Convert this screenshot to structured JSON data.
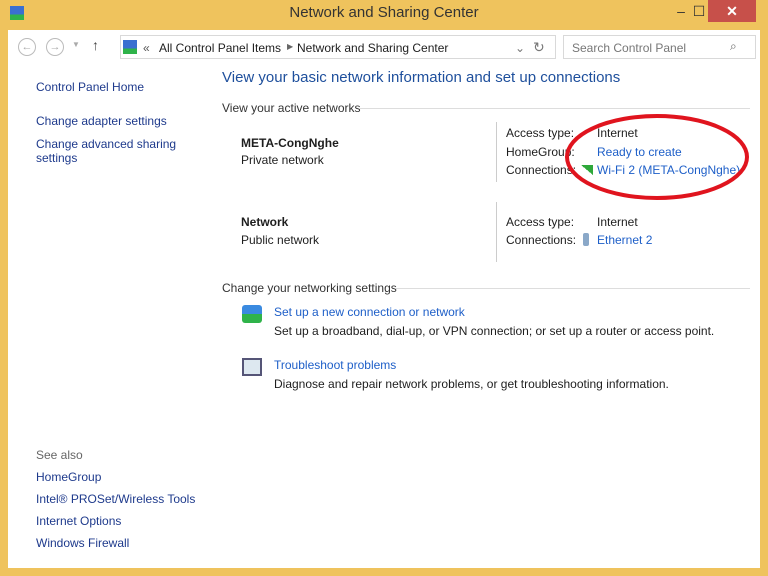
{
  "window": {
    "title": "Network and Sharing Center",
    "minimize": "‒",
    "maximize": "☐",
    "close": "✕"
  },
  "toolbar": {
    "back": "←",
    "forward": "→",
    "up": "↑",
    "breadcrumb_sep": "«",
    "crumbs": [
      "All Control Panel Items",
      "Network and Sharing Center"
    ],
    "search_placeholder": "Search Control Panel"
  },
  "sidebar": {
    "home": "Control Panel Home",
    "items": [
      "Change adapter settings",
      "Change advanced sharing settings"
    ],
    "see_also_label": "See also",
    "see_also": [
      "HomeGroup",
      "Intel® PROSet/Wireless Tools",
      "Internet Options",
      "Windows Firewall"
    ]
  },
  "main": {
    "heading": "View your basic network information and set up connections",
    "active_label": "View your active networks",
    "networks": [
      {
        "name": "META-CongNghe",
        "type": "Private network",
        "access_label": "Access type:",
        "access": "Internet",
        "homegroup_label": "HomeGroup:",
        "homegroup": "Ready to create",
        "conn_label": "Connections:",
        "conn": "Wi-Fi 2 (META-CongNghe)"
      },
      {
        "name": "Network",
        "type": "Public network",
        "access_label": "Access type:",
        "access": "Internet",
        "conn_label": "Connections:",
        "conn": "Ethernet 2"
      }
    ],
    "settings_label": "Change your networking settings",
    "tasks": [
      {
        "title": "Set up a new connection or network",
        "desc": "Set up a broadband, dial-up, or VPN connection; or set up a router or access point."
      },
      {
        "title": "Troubleshoot problems",
        "desc": "Diagnose and repair network problems, or get troubleshooting information."
      }
    ]
  },
  "colors": {
    "frame": "#efc35d",
    "link": "#1e5fc8",
    "annotation": "#e0141e"
  }
}
